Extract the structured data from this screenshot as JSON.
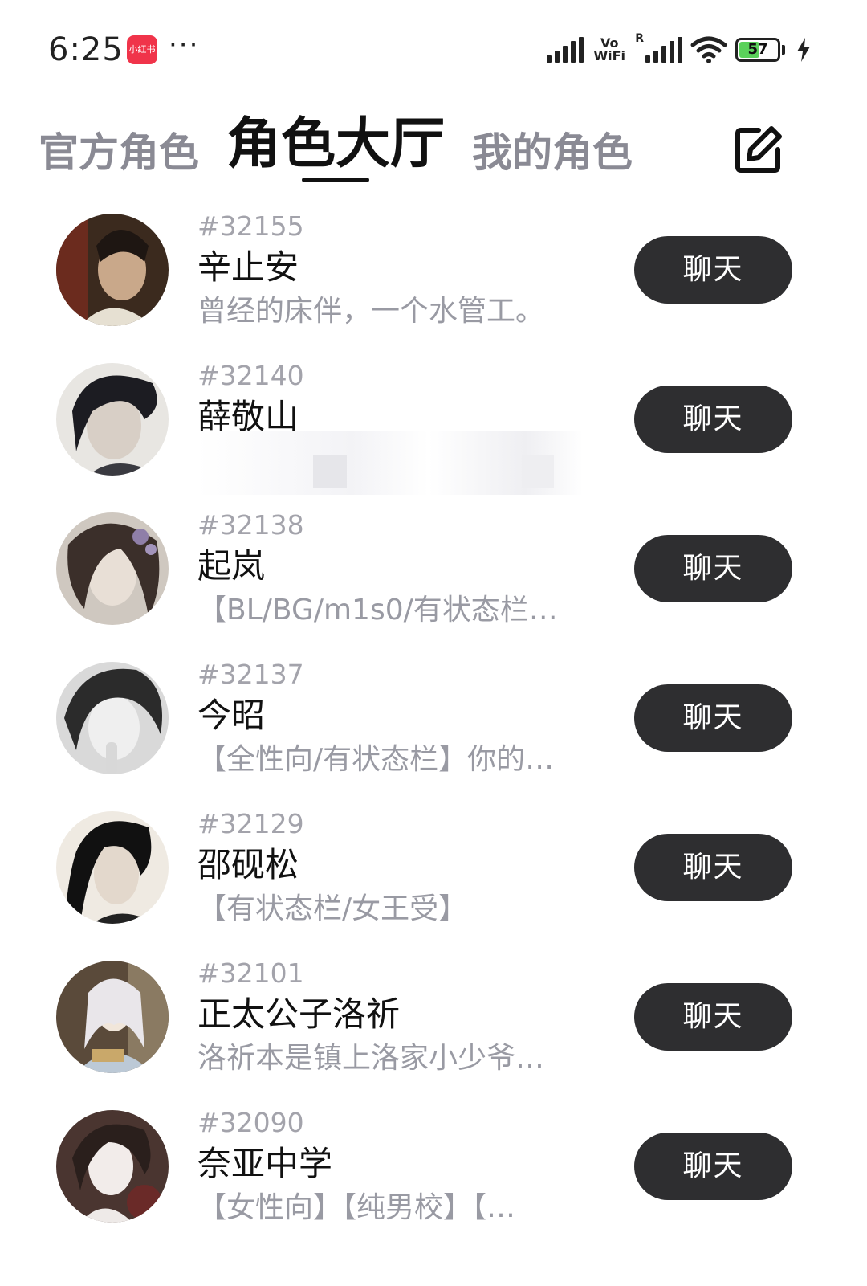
{
  "status_bar": {
    "time": "6:25",
    "app_badge": "小红书",
    "dots": "···",
    "vowifi": "Vo WiFi",
    "roaming": "R",
    "battery": "57"
  },
  "tabs": {
    "official": "官方角色",
    "hall": "角色大厅",
    "mine": "我的角色",
    "active": "hall"
  },
  "roles": [
    {
      "id": "#32155",
      "name": "辛止安",
      "desc": "曾经的床伴，一个水管工。",
      "chat": "聊天"
    },
    {
      "id": "#32140",
      "name": "薛敬山",
      "desc": "",
      "chat": "聊天"
    },
    {
      "id": "#32138",
      "name": "起岚",
      "desc": "【BL/BG/m1s0/有状态栏…",
      "chat": "聊天"
    },
    {
      "id": "#32137",
      "name": "今昭",
      "desc": "【全性向/有状态栏】你的…",
      "chat": "聊天"
    },
    {
      "id": "#32129",
      "name": "邵砚松",
      "desc": "【有状态栏/女王受】",
      "chat": "聊天"
    },
    {
      "id": "#32101",
      "name": "正太公子洛祈",
      "desc": "洛祈本是镇上洛家小少爷…",
      "chat": "聊天"
    },
    {
      "id": "#32090",
      "name": "奈亚中学",
      "desc": "【女性向】【纯男校】【…",
      "chat": "聊天"
    }
  ],
  "colors": {
    "button_bg": "#2e2e30",
    "inactive_tab": "#8a8a94",
    "secondary_text": "#999aa3",
    "battery_fill": "#5ad15a",
    "app_badge": "#f0344a"
  },
  "icons": {
    "edit": "edit-square-icon",
    "signal": "signal-bars-icon",
    "wifi": "wifi-icon",
    "battery": "battery-icon",
    "charging": "bolt-icon"
  }
}
